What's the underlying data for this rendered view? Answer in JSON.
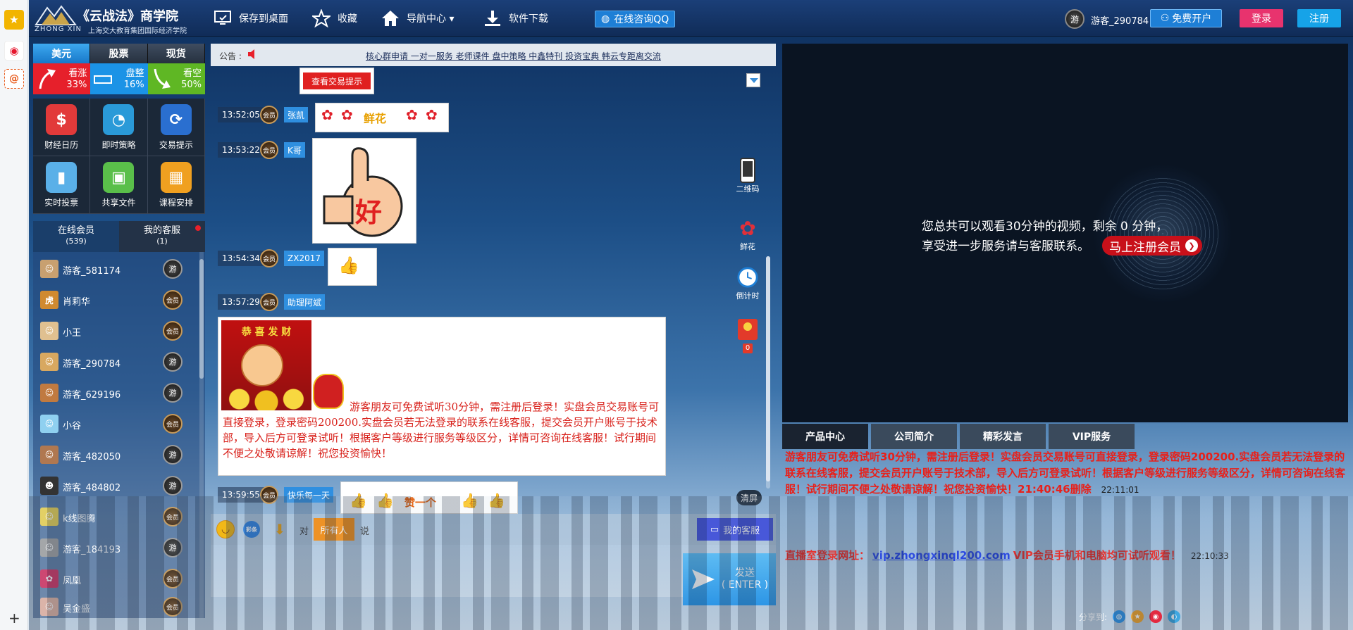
{
  "header": {
    "logo_title": "《云战法》商学院",
    "logo_zx": "ZHONG XIN",
    "logo_sub": "上海交大教育集团国际经济学院",
    "nav": [
      {
        "label": "保存到桌面",
        "icon": "desktop-icon"
      },
      {
        "label": "收藏",
        "icon": "star-icon"
      },
      {
        "label": "导航中心 ▾",
        "icon": "home-icon"
      },
      {
        "label": "软件下载",
        "icon": "download-icon"
      }
    ],
    "qq_consult": "在线咨询QQ",
    "user_avatar_text": "游",
    "username": "游客_290784",
    "open_account": "免费开户",
    "login": "登录",
    "register": "注册"
  },
  "market": {
    "tabs": [
      "美元",
      "股票",
      "现货"
    ],
    "sentiment": [
      {
        "label": "看涨",
        "value": "33%",
        "fraction": 0.33
      },
      {
        "label": "盘整",
        "value": "16%",
        "fraction": 0.16
      },
      {
        "label": "看空",
        "value": "50%",
        "fraction": 0.5
      }
    ]
  },
  "tools": [
    {
      "label": "财经日历",
      "glyph": "$",
      "color": "#e23a3a"
    },
    {
      "label": "即时策略",
      "glyph": "◔",
      "color": "#2a9ad8"
    },
    {
      "label": "交易提示",
      "glyph": "⟳",
      "color": "#2a6fd0"
    },
    {
      "label": "实时投票",
      "glyph": "▮",
      "color": "#5ab0e8"
    },
    {
      "label": "共享文件",
      "glyph": "▣",
      "color": "#5abf4a"
    },
    {
      "label": "课程安排",
      "glyph": "▦",
      "color": "#f0a020"
    }
  ],
  "members_panel": {
    "tab_online": "在线会员",
    "online_count": "(539)",
    "tab_service": "我的客服",
    "service_count": "(1)"
  },
  "members": [
    {
      "name": "游客_581174",
      "badge": "游"
    },
    {
      "name": "肖莉华",
      "badge": "会员"
    },
    {
      "name": "小王",
      "badge": "会员"
    },
    {
      "name": "游客_290784",
      "badge": "游"
    },
    {
      "name": "游客_629196",
      "badge": "游"
    },
    {
      "name": "小谷",
      "badge": "会员"
    },
    {
      "name": "游客_482050",
      "badge": "游"
    },
    {
      "name": "游客_484802",
      "badge": "游"
    },
    {
      "name": "k线图腾",
      "badge": "会员"
    },
    {
      "name": "游客_184193",
      "badge": "游"
    },
    {
      "name": "凤凰",
      "badge": "会员"
    },
    {
      "name": "吴金盛",
      "badge": "会员"
    }
  ],
  "notice": {
    "label": "公告 :",
    "text": "核心群申请 一对一服务 老师课件 盘中策略 中鑫特刊 投资宝典 韩云专距离交流"
  },
  "chat": {
    "tip_button": "查看交易提示",
    "member_badge": "会员",
    "messages": [
      {
        "time": "13:52:05",
        "name": "张凯",
        "content": "鲜花"
      },
      {
        "time": "13:53:22",
        "name": "K哥",
        "content": "好"
      },
      {
        "time": "13:54:34",
        "name": "ZX2017",
        "content": "👍"
      },
      {
        "time": "13:57:29",
        "name": "助理阿斌",
        "content": "游客朋友可免费试听30分钟，需注册后登录！实盘会员交易账号可直接登录，登录密码200200.实盘会员若无法登录的联系在线客服，提交会员开户账号于技术部，导入后方可登录试听！根据客户等级进行服务等级区分，详情可咨询在线客服！试行期间不便之处敬请谅解！祝您投资愉快！"
      },
      {
        "time": "13:59:55",
        "name": "快乐每一天",
        "content": "赞一个"
      }
    ],
    "banner_text": "恭 喜 发 财",
    "side": [
      {
        "label": "二维码"
      },
      {
        "label": "鲜花"
      },
      {
        "label": "倒计时"
      },
      {
        "label": "0"
      }
    ],
    "clear": "清屏"
  },
  "input_bar": {
    "color_btn": "彩条",
    "to": "对",
    "target": "所有人",
    "say": "说",
    "service": "我的客服",
    "send": "发送",
    "send_hint": "( ENTER )"
  },
  "video": {
    "line1": "您总共可以观看30分钟的视频，剩余 0 分钟，",
    "line2": "享受进一步服务请与客服联系。",
    "register_btn": "马上注册会员"
  },
  "right_tabs": [
    "产品中心",
    "公司简介",
    "精彩发言",
    "VIP服务"
  ],
  "info": {
    "p1": "游客朋友可免费试听30分钟，需注册后登录！实盘会员交易账号可直接登录，登录密码200200.实盘会员若无法登录的联系在线客服，提交会员开户账号于技术部，导入后方可登录试听！根据客户等级进行服务等级区分，详情可咨询在线客服！试行期间不便之处敬请谅解！祝您投资愉快！21:40:46删除",
    "p1_time": "22:11:01",
    "p2_prefix": "直播室登录网址：",
    "p2_url": "vip.zhongxinql200.com",
    "p2_suffix": "VIP会员手机和电脑均可试听观看！",
    "p2_time": "22:10:33"
  },
  "share_label": "分享到:"
}
